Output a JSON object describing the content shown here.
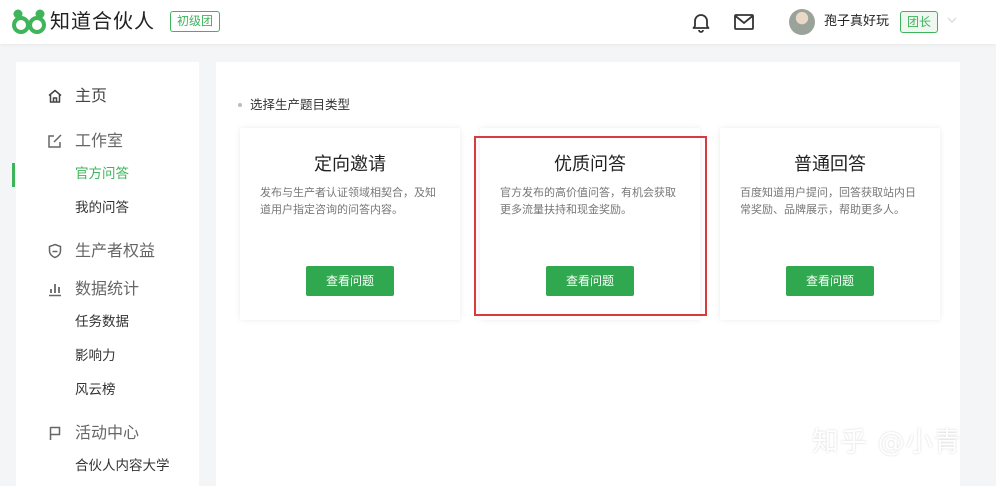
{
  "header": {
    "brand": "知道合伙人",
    "level_badge": "初级团",
    "username": "孢子真好玩",
    "role_badge": "团长",
    "icons": {
      "logo": "zhidao-logo",
      "bell": "bell-icon",
      "mail": "mail-icon"
    },
    "accent": "#3eb55b"
  },
  "sidebar": {
    "groups": [
      {
        "label": "主页",
        "icon": "home-icon"
      },
      {
        "label": "工作室",
        "icon": "edit-icon",
        "items": [
          {
            "label": "官方问答",
            "active": true
          },
          {
            "label": "我的问答",
            "active": false
          }
        ]
      },
      {
        "label": "生产者权益",
        "icon": "shield-icon"
      },
      {
        "label": "数据统计",
        "icon": "bar-chart-icon",
        "items": [
          {
            "label": "任务数据"
          },
          {
            "label": "影响力"
          },
          {
            "label": "风云榜"
          }
        ]
      },
      {
        "label": "活动中心",
        "icon": "flag-icon",
        "items": [
          {
            "label": "合伙人内容大学"
          }
        ]
      }
    ]
  },
  "main": {
    "section_title": "选择生产题目类型",
    "cards": [
      {
        "title": "定向邀请",
        "desc": "发布与生产者认证领域相契合，及知道用户指定咨询的问答内容。",
        "button": "查看问题"
      },
      {
        "title": "优质问答",
        "desc": "官方发布的高价值问答，有机会获取更多流量扶持和现金奖励。",
        "button": "查看问题"
      },
      {
        "title": "普通回答",
        "desc": "百度知道用户提问，回答获取站内日常奖励、品牌展示，帮助更多人。",
        "button": "查看问题"
      }
    ],
    "button_color": "#2fa84f",
    "highlight_color": "#d93b3b"
  },
  "watermark": "知乎 @小青"
}
